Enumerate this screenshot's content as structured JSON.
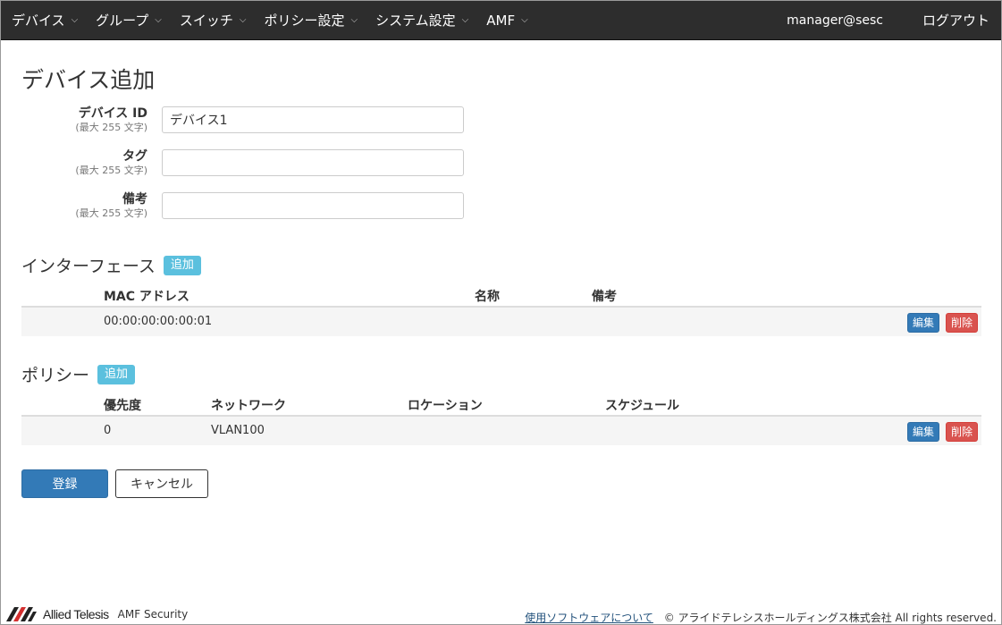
{
  "nav": {
    "items": [
      {
        "label": "デバイス"
      },
      {
        "label": "グループ"
      },
      {
        "label": "スイッチ"
      },
      {
        "label": "ポリシー設定"
      },
      {
        "label": "システム設定"
      },
      {
        "label": "AMF"
      }
    ],
    "caret_icon": "chevron-down-icon",
    "user": "manager@sesc",
    "logout": "ログアウト"
  },
  "page": {
    "title": "デバイス追加"
  },
  "form": {
    "device_id": {
      "label": "デバイス ID",
      "hint": "(最大 255 文字)",
      "value": "デバイス1"
    },
    "tag": {
      "label": "タグ",
      "hint": "(最大 255 文字)",
      "value": ""
    },
    "note": {
      "label": "備考",
      "hint": "(最大 255 文字)",
      "value": ""
    }
  },
  "interfaces": {
    "title": "インターフェース",
    "add_label": "追加",
    "columns": {
      "mac": "MAC アドレス",
      "name": "名称",
      "note": "備考"
    },
    "rows": [
      {
        "mac": "00:00:00:00:00:01",
        "name": "",
        "note": ""
      }
    ],
    "edit_label": "編集",
    "delete_label": "削除"
  },
  "policies": {
    "title": "ポリシー",
    "add_label": "追加",
    "columns": {
      "priority": "優先度",
      "network": "ネットワーク",
      "location": "ロケーション",
      "schedule": "スケジュール"
    },
    "rows": [
      {
        "priority": "0",
        "network": "VLAN100",
        "location": "",
        "schedule": ""
      }
    ],
    "edit_label": "編集",
    "delete_label": "削除"
  },
  "actions": {
    "submit": "登録",
    "cancel": "キャンセル"
  },
  "footer": {
    "brand": "Allied Telesis",
    "product": "AMF Security",
    "link": "使用ソフトウェアについて",
    "copyright": "© アライドテレシスホールディングス株式会社 All rights reserved."
  },
  "colors": {
    "navbar": "#2d2d2d",
    "primary": "#337ab7",
    "info": "#5bc0de",
    "danger": "#d9534f"
  }
}
